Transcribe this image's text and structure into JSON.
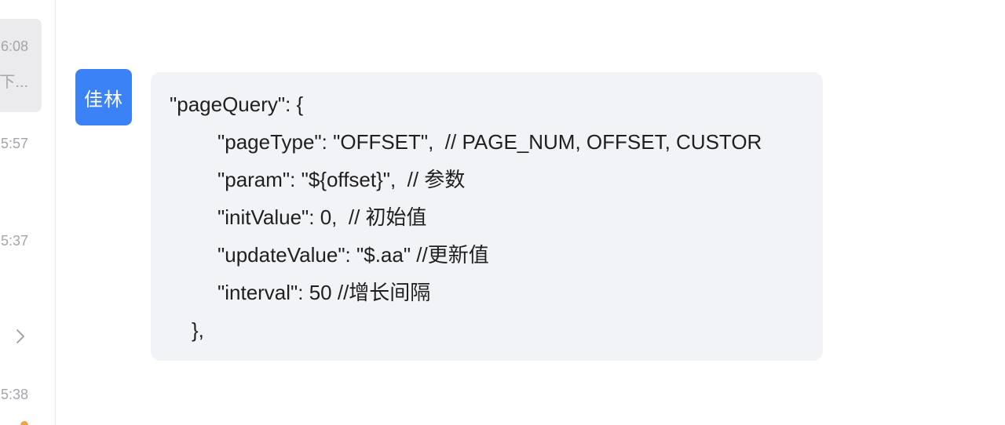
{
  "sidebar": {
    "conversations": [
      {
        "time": "6:08",
        "snippet": "下..."
      },
      {
        "time": "5:57"
      },
      {
        "time": "5:37"
      },
      {
        "time": "5:38"
      }
    ],
    "expand_icon": "chevron-right-icon"
  },
  "message": {
    "sender_avatar": "佳林",
    "lines": [
      "\"pageQuery\": {",
      "\"pageType\": \"OFFSET\",  // PAGE_NUM, OFFSET, CUSTOR",
      "\"param\": \"${offset}\",  // 参数",
      "\"initValue\": 0,  // 初始值",
      "\"updateValue\": \"$.aa\" //更新值",
      "\"interval\": 50 //增长间隔",
      "},"
    ]
  },
  "colors": {
    "avatar_bg": "#3b82f6",
    "bubble_bg": "#f2f3f7",
    "muted_text": "#a3a5aa"
  }
}
